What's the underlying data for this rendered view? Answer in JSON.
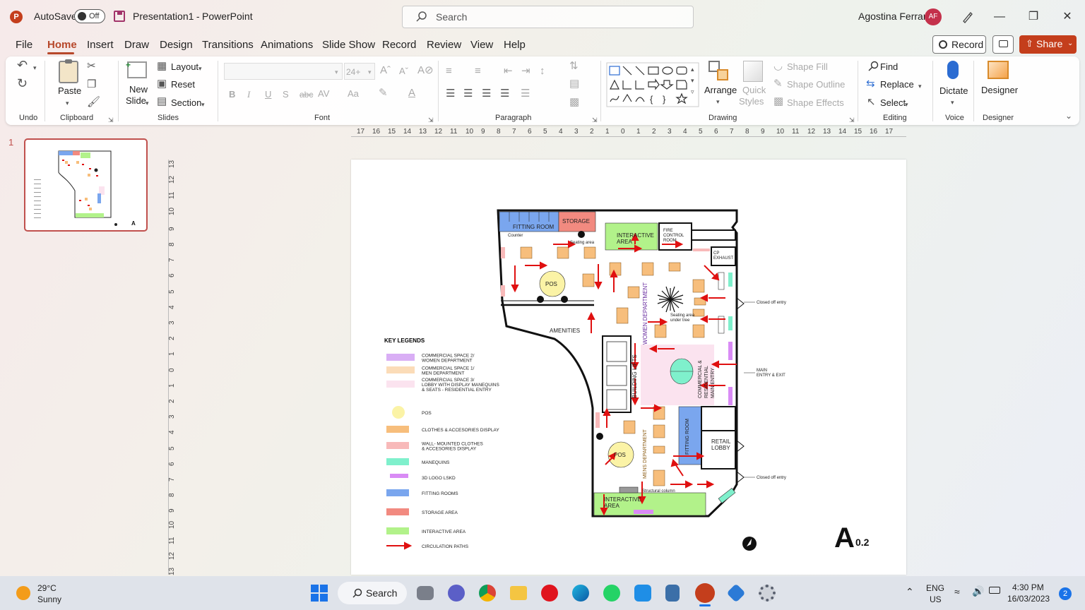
{
  "window": {
    "autosave_label": "AutoSave",
    "autosave_state": "Off",
    "doc_title": "Presentation1",
    "app_sep": " - ",
    "app_name": "PowerPoint",
    "search_placeholder": "Search",
    "user_name": "Agostina Ferrari",
    "user_initials": "AF"
  },
  "menu": {
    "tabs": [
      "File",
      "Home",
      "Insert",
      "Draw",
      "Design",
      "Transitions",
      "Animations",
      "Slide Show",
      "Record",
      "Review",
      "View",
      "Help"
    ],
    "record_btn": "Record",
    "share_btn": "Share"
  },
  "ribbon": {
    "undo_group": "Undo",
    "paste": "Paste",
    "clipboard_group": "Clipboard",
    "new_slide_1": "New",
    "new_slide_2": "Slide",
    "layout": "Layout",
    "reset": "Reset",
    "section": "Section",
    "slides_group": "Slides",
    "font_size": "24+",
    "bold": "B",
    "italic": "I",
    "underline": "U",
    "strike": "S",
    "font_group": "Font",
    "paragraph_group": "Paragraph",
    "arrange": "Arrange",
    "quick_styles_1": "Quick",
    "quick_styles_2": "Styles",
    "shape_fill": "Shape Fill",
    "shape_outline": "Shape Outline",
    "shape_effects": "Shape Effects",
    "drawing_group": "Drawing",
    "find": "Find",
    "replace": "Replace",
    "select": "Select",
    "editing_group": "Editing",
    "dictate": "Dictate",
    "voice_group": "Voice",
    "designer": "Designer",
    "designer_group": "Designer"
  },
  "hruler_labels": [
    "17",
    "16",
    "15",
    "14",
    "13",
    "12",
    "11",
    "10",
    "9",
    "8",
    "7",
    "6",
    "5",
    "4",
    "3",
    "2",
    "1",
    "0",
    "1",
    "2",
    "3",
    "4",
    "5",
    "6",
    "7",
    "8",
    "9",
    "10",
    "11",
    "12",
    "13",
    "14",
    "15",
    "16",
    "17"
  ],
  "vruler_labels": [
    "13",
    "12",
    "11",
    "10",
    "9",
    "8",
    "7",
    "6",
    "5",
    "4",
    "3",
    "2",
    "1",
    "0",
    "1",
    "2",
    "3",
    "4",
    "5",
    "6",
    "7",
    "8",
    "9",
    "10",
    "11",
    "12",
    "13"
  ],
  "thumbnail": {
    "number": "1"
  },
  "slide": {
    "legend_title": "KEY LEGENDS",
    "legend": [
      {
        "label": "COMMERCIAL SPACE 2/\nWOMEN DEPARTMENT",
        "color": "#d9aef5"
      },
      {
        "label": "COMMERCIAL SPACE 1/\nMEN DEPARTMENT",
        "color": "#fbdcb8"
      },
      {
        "label": "COMMERCIAL SPACE 3/\nLOBBY WITH DISPLAY MANEQUINS\n& SEATS - RESIDENTIAL ENTRY",
        "color": "#fbe3ef"
      },
      {
        "label": "POS",
        "color": "#fbf3a6"
      },
      {
        "label": "CLOTHES & ACCESORIES DISPLAY",
        "color": "#f7be7c"
      },
      {
        "label": "WALL- MOUNTED CLOTHES\n& ACCESORIES DISPLAY",
        "color": "#f8b9b9"
      },
      {
        "label": "MANEQUINS",
        "color": "#7ff0cc"
      },
      {
        "label": "3D LOGO LSKD",
        "color": "#d98bf5"
      },
      {
        "label": "FITTING ROOMS",
        "color": "#7aa6ee"
      },
      {
        "label": "STORAGE AREA",
        "color": "#f28a80"
      },
      {
        "label": "INTERACTIVE AREA",
        "color": "#b2f28a"
      },
      {
        "label": "CIRCULATION PATHS",
        "color": "#e01010"
      }
    ],
    "plan_labels": {
      "fitting_room": "FITTING ROOM",
      "storage": "STORAGE",
      "interactive_top": "INTERACTIVE\nAREA",
      "fire_control": "FIRE\nCONTROL\nROOM",
      "cp_exhaust": "CP\nEXHAUST",
      "counter": "Counter",
      "seating_area": "Seating area",
      "pos": "POS",
      "amenities": "AMENITIES",
      "women_dept": "WOMEN DEPARTMENT",
      "seating_tree": "Seating area\nunder tree",
      "building_lifts": "BUILDING LIFTS",
      "lobby_entry": "COMMERCIAL &\nRESIDENTIAL\nMAIN ENTRY",
      "fitting_room_v": "FITTING ROOM",
      "retail_lobby": "RETAIL\nLOBBY",
      "mens_dept": "MENS DEPARTMENT",
      "structural_column": "Structural column",
      "interactive_bottom": "INTERACTIVE\nAREA",
      "closed_entry": "Closed off entry",
      "main_entry": "MAIN\nENTRY & EXIT"
    },
    "sheet_letter": "A",
    "sheet_num": "0.2"
  },
  "taskbar": {
    "weather_temp": "29°C",
    "weather_desc": "Sunny",
    "search": "Search",
    "lang_1": "ENG",
    "lang_2": "US",
    "time": "4:30 PM",
    "date": "16/03/2023",
    "notif": "2"
  }
}
